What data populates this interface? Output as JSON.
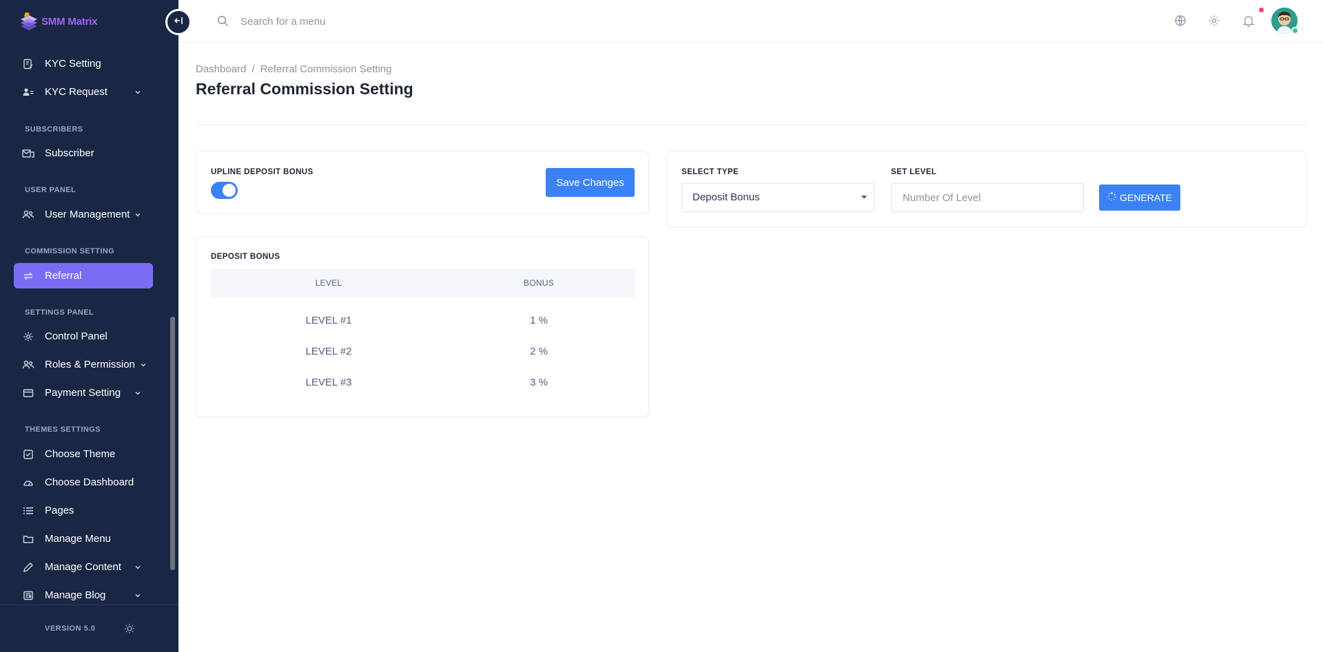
{
  "sidebar": {
    "brand": "SMM Matrix",
    "collapse_icon": "arrow-left-bar-icon",
    "items": [
      {
        "label": "KYC Setting",
        "icon": "file-edit-icon",
        "chevron": false
      },
      {
        "label": "KYC Request",
        "icon": "user-list-icon",
        "chevron": true
      },
      {
        "label": "Subscriber",
        "icon": "mail-group-icon",
        "chevron": false
      },
      {
        "label": "User Management",
        "icon": "users-icon",
        "chevron": true
      },
      {
        "label": "Referral",
        "icon": "refresh-arrows-icon",
        "chevron": false,
        "active": true
      },
      {
        "label": "Control Panel",
        "icon": "gear-icon",
        "chevron": false
      },
      {
        "label": "Roles & Permission",
        "icon": "users-icon",
        "chevron": true
      },
      {
        "label": "Payment Setting",
        "icon": "credit-card-icon",
        "chevron": true
      },
      {
        "label": "Choose Theme",
        "icon": "check-square-icon",
        "chevron": false
      },
      {
        "label": "Choose Dashboard",
        "icon": "speedometer-icon",
        "chevron": false
      },
      {
        "label": "Pages",
        "icon": "list-icon",
        "chevron": false
      },
      {
        "label": "Manage Menu",
        "icon": "folder-icon",
        "chevron": false
      },
      {
        "label": "Manage Content",
        "icon": "pencil-icon",
        "chevron": true
      },
      {
        "label": "Manage Blog",
        "icon": "newspaper-icon",
        "chevron": true
      }
    ],
    "sections": [
      "SUBSCRIBERS",
      "USER PANEL",
      "COMMISSION SETTING",
      "SETTINGS PANEL",
      "THEMES SETTINGS"
    ],
    "version": "VERSION 5.0",
    "theme_toggle_icon": "sun-icon"
  },
  "topbar": {
    "search_placeholder": "Search for a menu",
    "icons": [
      "globe-icon",
      "gear-icon",
      "bell-icon"
    ],
    "notification_dot_color": "#f0407b"
  },
  "page": {
    "breadcrumb": [
      "Dashboard",
      "/",
      "Referral Commission Setting"
    ],
    "title": "Referral Commission Setting"
  },
  "upline_card": {
    "label": "UPLINE DEPOSIT BONUS",
    "toggle_on": true,
    "save_label": "Save Changes"
  },
  "bonus_table": {
    "label": "DEPOSIT BONUS",
    "headers": [
      "LEVEL",
      "BONUS"
    ],
    "rows": [
      {
        "level": "LEVEL #1",
        "bonus": "1 %"
      },
      {
        "level": "LEVEL #2",
        "bonus": "2 %"
      },
      {
        "level": "LEVEL #3",
        "bonus": "3 %"
      }
    ]
  },
  "generate_card": {
    "select_type_label": "SELECT TYPE",
    "select_value": "Deposit Bonus",
    "set_level_label": "SET LEVEL",
    "level_placeholder": "Number Of Level",
    "generate_label": "GENERATE"
  },
  "colors": {
    "sidebar_bg": "#1a2744",
    "active_item": "#7b6cf6",
    "primary": "#3b82f6",
    "brand_text": "#a064f5"
  }
}
